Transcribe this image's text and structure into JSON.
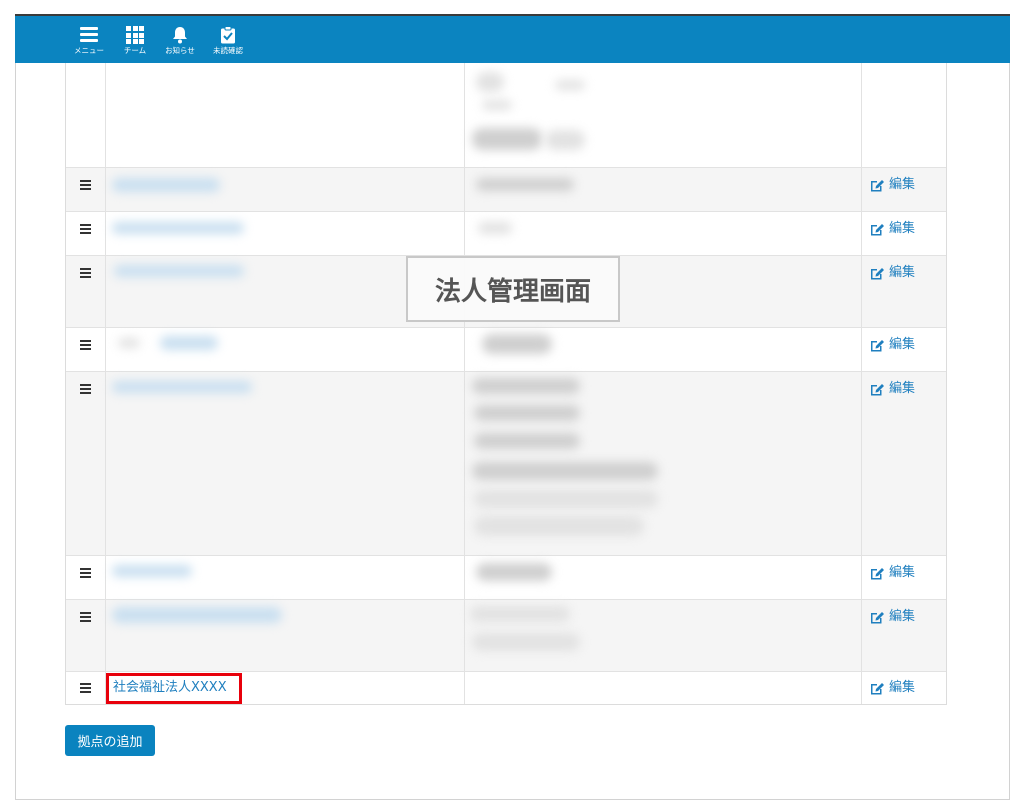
{
  "header": {
    "items": [
      {
        "label": "メニュー",
        "icon": "menu-icon"
      },
      {
        "label": "チーム",
        "icon": "grid-icon"
      },
      {
        "label": "お知らせ",
        "icon": "bell-icon"
      },
      {
        "label": "未読確認",
        "icon": "clipboard-check-icon"
      }
    ]
  },
  "overlay_label": "法人管理画面",
  "table": {
    "rows": [
      {},
      {
        "edit_label": "編集"
      },
      {
        "edit_label": "編集"
      },
      {
        "edit_label": "編集"
      },
      {
        "edit_label": "編集"
      },
      {
        "edit_label": "編集"
      },
      {
        "edit_label": "編集"
      },
      {
        "edit_label": "編集"
      },
      {
        "name": "社会福祉法人XXXX",
        "edit_label": "編集"
      }
    ]
  },
  "add_button": "拠点の追加",
  "colors": {
    "header_bg": "#0b84c0",
    "link": "#1f7fbf",
    "highlight": "#e8000b",
    "button_bg": "#0a83bf"
  }
}
